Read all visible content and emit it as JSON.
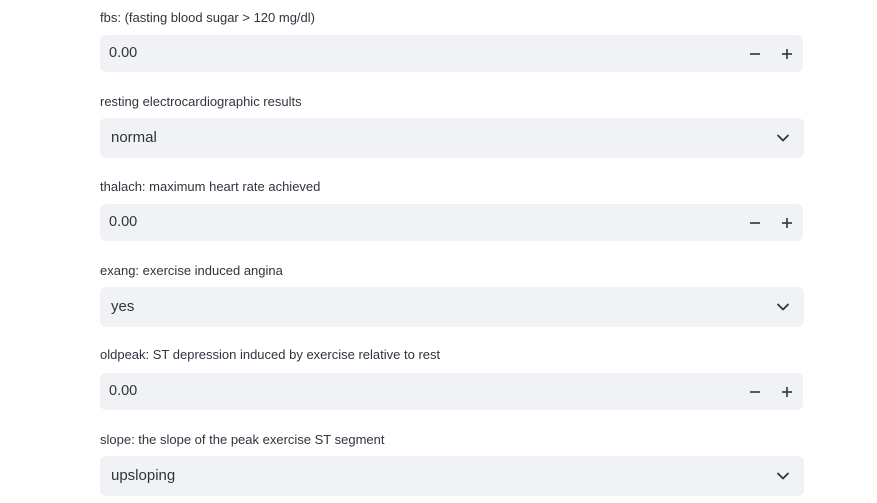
{
  "fields": [
    {
      "type": "number",
      "label": "fbs: (fasting blood sugar > 120 mg/dl)",
      "value": "0.00",
      "minus_icon": "minus-icon",
      "plus_icon": "plus-icon"
    },
    {
      "type": "select",
      "label": "resting electrocardiographic results",
      "value": "normal",
      "icon": "chevron-down-icon"
    },
    {
      "type": "number",
      "label": "thalach: maximum heart rate achieved",
      "value": "0.00",
      "minus_icon": "minus-icon",
      "plus_icon": "plus-icon"
    },
    {
      "type": "select",
      "label": "exang: exercise induced angina",
      "value": "yes",
      "icon": "chevron-down-icon"
    },
    {
      "type": "number",
      "label": "oldpeak: ST depression induced by exercise relative to rest",
      "value": "0.00",
      "minus_icon": "minus-icon",
      "plus_icon": "plus-icon"
    },
    {
      "type": "select",
      "label": "slope: the slope of the peak exercise ST segment",
      "value": "upsloping",
      "icon": "chevron-down-icon"
    }
  ]
}
